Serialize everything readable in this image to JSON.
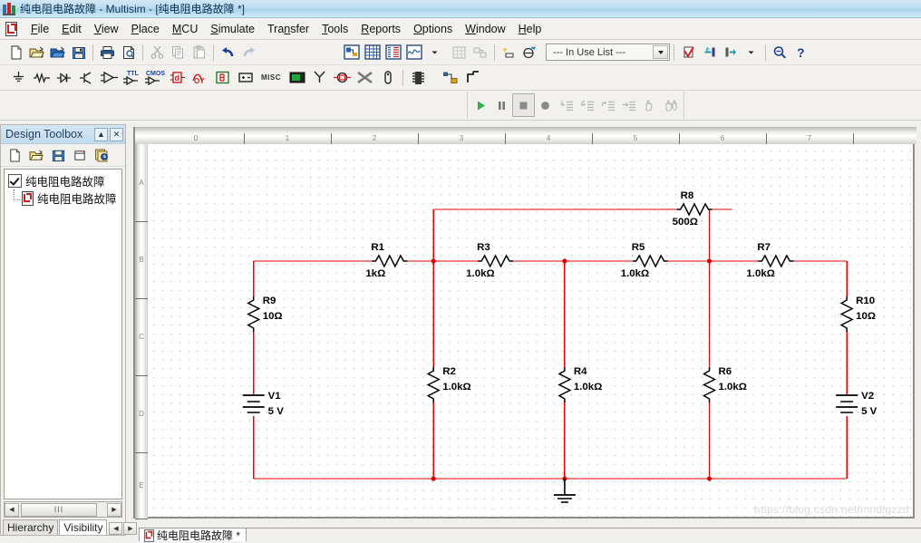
{
  "window": {
    "title": "纯电阻电路故障 - Multisim - [纯电阻电路故障 *]",
    "icon": "multisim-icon"
  },
  "menubar": {
    "doc_icon": "document-icon",
    "items": [
      {
        "label": "File",
        "mnemonic": "F"
      },
      {
        "label": "Edit",
        "mnemonic": "E"
      },
      {
        "label": "View",
        "mnemonic": "V"
      },
      {
        "label": "Place",
        "mnemonic": "P"
      },
      {
        "label": "MCU",
        "mnemonic": "M"
      },
      {
        "label": "Simulate",
        "mnemonic": "S"
      },
      {
        "label": "Transfer",
        "mnemonic": "n"
      },
      {
        "label": "Tools",
        "mnemonic": "T"
      },
      {
        "label": "Reports",
        "mnemonic": "R"
      },
      {
        "label": "Options",
        "mnemonic": "O"
      },
      {
        "label": "Window",
        "mnemonic": "W"
      },
      {
        "label": "Help",
        "mnemonic": "H"
      }
    ]
  },
  "standard_toolbar": {
    "buttons": [
      "new-file-icon",
      "open-file-icon",
      "open-design-icon",
      "save-icon",
      "print-icon",
      "print-preview-icon",
      "cut-icon",
      "copy-icon",
      "paste-icon",
      "undo-icon",
      "redo-icon"
    ],
    "view_buttons": [
      "toggle-design-toolbox-icon",
      "toggle-spreadsheet-view-icon",
      "toggle-spice-netlist-icon",
      "toggle-grapher-icon"
    ],
    "dropdown_arrow": "chevron-down-icon",
    "extra_buttons": [
      "spreadsheet-icon",
      "back-annotate-icon"
    ],
    "parts_buttons": [
      "create-component-icon",
      "graph-analysis-icon"
    ],
    "in_use_list": {
      "label": "--- In Use List ---",
      "arrow": "chevron-down-icon"
    },
    "check_buttons": [
      "erc-check-icon",
      "transfer-in-icon",
      "transfer-out-icon"
    ],
    "transfer_arrow": "chevron-down-icon",
    "right_buttons": [
      "search-component-icon",
      "help-icon"
    ]
  },
  "components_toolbar": {
    "buttons": [
      "source-icon",
      "basic-icon",
      "diode-icon",
      "transistor-icon",
      "analog-icon",
      "ttl-icon",
      "cmos-icon",
      "misc-digital-icon",
      "mixed-icon",
      "indicator-icon",
      "power-icon",
      "misc-icon",
      "advanced-peripherals-icon",
      "rf-icon",
      "electromechanical-icon",
      "ni-components-icon",
      "connectors-icon",
      "mcu-icon",
      "hierarchical-block-icon",
      "bus-icon"
    ],
    "misc_label": "MISC"
  },
  "simulation_toolbar": {
    "buttons": [
      {
        "name": "run-button",
        "glyph": "play",
        "state": "enabled"
      },
      {
        "name": "pause-button",
        "glyph": "pause",
        "state": "enabled"
      },
      {
        "name": "stop-button",
        "glyph": "stop",
        "state": "pressed"
      },
      {
        "name": "record-button",
        "glyph": "record",
        "state": "enabled"
      },
      {
        "name": "step-into-button",
        "glyph": "step-into",
        "state": "disabled"
      },
      {
        "name": "step-over-button",
        "glyph": "step-over",
        "state": "disabled"
      },
      {
        "name": "step-out-button",
        "glyph": "step-out",
        "state": "disabled"
      },
      {
        "name": "run-to-cursor-button",
        "glyph": "run-to-cursor",
        "state": "disabled"
      },
      {
        "name": "pause-at-button",
        "glyph": "hand",
        "state": "disabled"
      },
      {
        "name": "stop-at-button",
        "glyph": "hands",
        "state": "disabled"
      }
    ]
  },
  "design_toolbox": {
    "title": "Design Toolbox",
    "minimize_label": "▲",
    "close_label": "✕",
    "toolbar_icons": [
      "new-design-icon",
      "open-design-icon",
      "save-design-icon",
      "new-sheet-icon",
      "refresh-tree-icon"
    ],
    "tree": {
      "root_label": "纯电阻电路故障",
      "child_label": "纯电阻电路故障",
      "root_icon": "checked-design-icon",
      "child_icon": "schematic-file-icon"
    },
    "scrollbar": {
      "left_arrow": "◀",
      "right_arrow": "▶",
      "thumb": "III"
    },
    "tabs": [
      {
        "label": "Hierarchy",
        "active": false
      },
      {
        "label": "Visibility",
        "active": true
      }
    ],
    "tab_arrows": [
      "◀",
      "▶"
    ]
  },
  "canvas": {
    "ruler_h": [
      "0",
      "1",
      "2",
      "3",
      "4",
      "5",
      "6",
      "7"
    ],
    "ruler_v": [
      "A",
      "B",
      "C",
      "D",
      "E"
    ],
    "watermark": "https://blog.csdn.net/mndlgzzd",
    "document_tab": "纯电阻电路故障 *",
    "document_tab_icon": "schematic-file-icon",
    "wire_color": "#ee0000",
    "symbol_color": "#000000",
    "junction_color": "#dd0000"
  },
  "circuit": {
    "components": [
      {
        "ref": "R1",
        "value": "1kΩ",
        "type": "resistor",
        "orientation": "horizontal"
      },
      {
        "ref": "R2",
        "value": "1.0kΩ",
        "type": "resistor",
        "orientation": "vertical"
      },
      {
        "ref": "R3",
        "value": "1.0kΩ",
        "type": "resistor",
        "orientation": "horizontal"
      },
      {
        "ref": "R4",
        "value": "1.0kΩ",
        "type": "resistor",
        "orientation": "vertical"
      },
      {
        "ref": "R5",
        "value": "1.0kΩ",
        "type": "resistor",
        "orientation": "horizontal"
      },
      {
        "ref": "R6",
        "value": "1.0kΩ",
        "type": "resistor",
        "orientation": "vertical"
      },
      {
        "ref": "R7",
        "value": "1.0kΩ",
        "type": "resistor",
        "orientation": "horizontal"
      },
      {
        "ref": "R8",
        "value": "500Ω",
        "type": "resistor",
        "orientation": "horizontal"
      },
      {
        "ref": "R9",
        "value": "10Ω",
        "type": "resistor",
        "orientation": "vertical"
      },
      {
        "ref": "R10",
        "value": "10Ω",
        "type": "resistor",
        "orientation": "vertical"
      },
      {
        "ref": "V1",
        "value": "5 V",
        "type": "dc-voltage-source",
        "orientation": "vertical"
      },
      {
        "ref": "V2",
        "value": "5 V",
        "type": "dc-voltage-source",
        "orientation": "vertical"
      },
      {
        "ref": "GND",
        "value": "",
        "type": "ground",
        "orientation": "vertical"
      }
    ]
  }
}
